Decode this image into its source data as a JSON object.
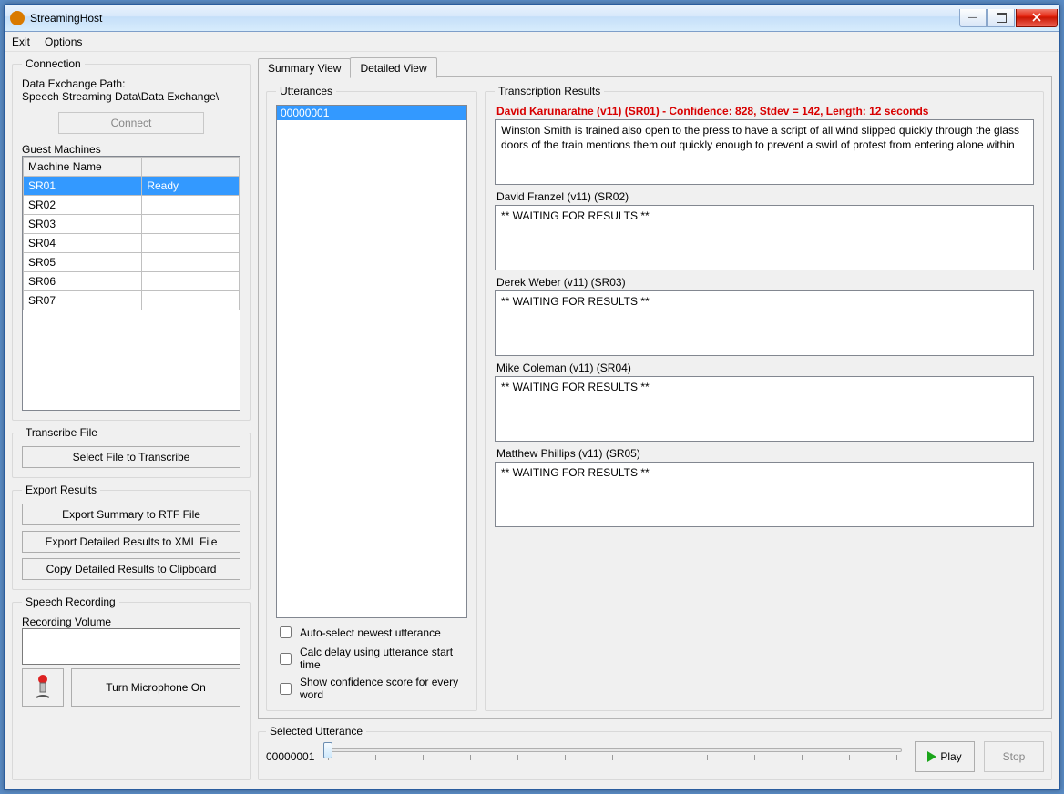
{
  "window": {
    "title": "StreamingHost"
  },
  "menu": {
    "exit": "Exit",
    "options": "Options"
  },
  "connection": {
    "legend": "Connection",
    "pathlabel": "Data Exchange Path:",
    "path": "Speech Streaming Data\\Data Exchange\\",
    "connect": "Connect",
    "guestlegend": "Guest Machines",
    "col_machine": "Machine Name",
    "col_status": "",
    "machines": [
      {
        "name": "SR01",
        "status": "Ready",
        "selected": true
      },
      {
        "name": "SR02",
        "status": ""
      },
      {
        "name": "SR03",
        "status": ""
      },
      {
        "name": "SR04",
        "status": ""
      },
      {
        "name": "SR05",
        "status": ""
      },
      {
        "name": "SR06",
        "status": ""
      },
      {
        "name": "SR07",
        "status": ""
      }
    ]
  },
  "transcribe": {
    "legend": "Transcribe File",
    "select": "Select File to Transcribe"
  },
  "export": {
    "legend": "Export Results",
    "rtf": "Export Summary to RTF File",
    "xml": "Export Detailed Results to XML File",
    "clip": "Copy Detailed Results to Clipboard"
  },
  "recording": {
    "legend": "Speech Recording",
    "vol": "Recording Volume",
    "micon": "Turn Microphone On"
  },
  "tabs": {
    "summary": "Summary View",
    "detailed": "Detailed View"
  },
  "utter": {
    "legend": "Utterances",
    "items": [
      {
        "id": "00000001",
        "selected": true
      }
    ],
    "chk_auto": "Auto-select newest utterance",
    "chk_delay": "Calc delay using utterance start time",
    "chk_conf": "Show confidence score for every word"
  },
  "trans": {
    "legend": "Transcription Results",
    "best": {
      "header": "David Karunaratne (v11) (SR01) - Confidence: 828, Stdev = 142, Length: 12 seconds",
      "text": "Winston Smith is trained also open to the press to have a script of all wind slipped quickly through the glass doors of the train mentions them out quickly enough to prevent a swirl of protest from entering alone within"
    },
    "others": [
      {
        "header": "David Franzel (v11) (SR02)",
        "text": "** WAITING FOR RESULTS **"
      },
      {
        "header": "Derek Weber (v11) (SR03)",
        "text": "** WAITING FOR RESULTS **"
      },
      {
        "header": "Mike Coleman (v11) (SR04)",
        "text": "** WAITING FOR RESULTS **"
      },
      {
        "header": "Matthew Phillips (v11) (SR05)",
        "text": "** WAITING FOR RESULTS **"
      }
    ]
  },
  "selected": {
    "legend": "Selected Utterance",
    "value": "00000001",
    "play": "Play",
    "stop": "Stop"
  }
}
